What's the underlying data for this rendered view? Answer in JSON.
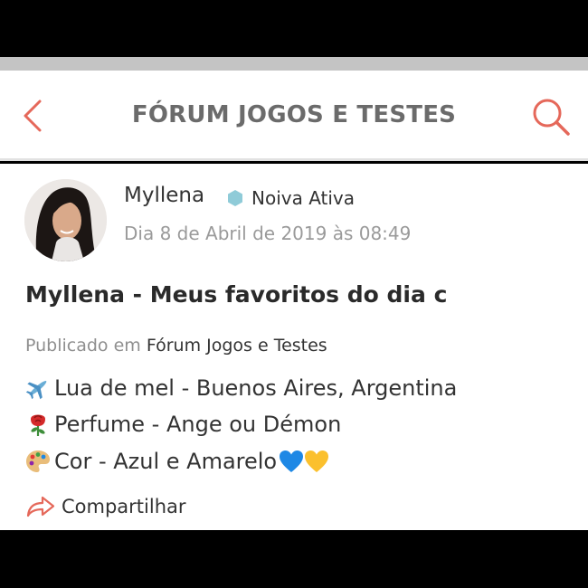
{
  "header": {
    "title": "FÓRUM JOGOS E TESTES",
    "back_icon": "chevron-left-icon",
    "search_icon": "search-icon",
    "accent_color": "#e5685a"
  },
  "post": {
    "author": "Myllena",
    "badge_label": "Noiva Ativa",
    "badge_color": "#8fcbd8",
    "date": "Dia 8 de Abril de 2019 às 08:49",
    "title": "Myllena - Meus favoritos do dia c",
    "published_prefix": "Publicado em",
    "published_forum": "Fórum Jogos e Testes",
    "favorites": [
      {
        "icon": "airplane-emoji",
        "text": "Lua de mel - Buenos Aires, Argentina"
      },
      {
        "icon": "rose-emoji",
        "text": "Perfume - Ange ou Démon"
      },
      {
        "icon": "palette-emoji",
        "text": "Cor - Azul e Amarelo",
        "trailing_icons": [
          "blue-heart-emoji",
          "yellow-heart-emoji"
        ]
      }
    ],
    "share_label": "Compartilhar"
  }
}
